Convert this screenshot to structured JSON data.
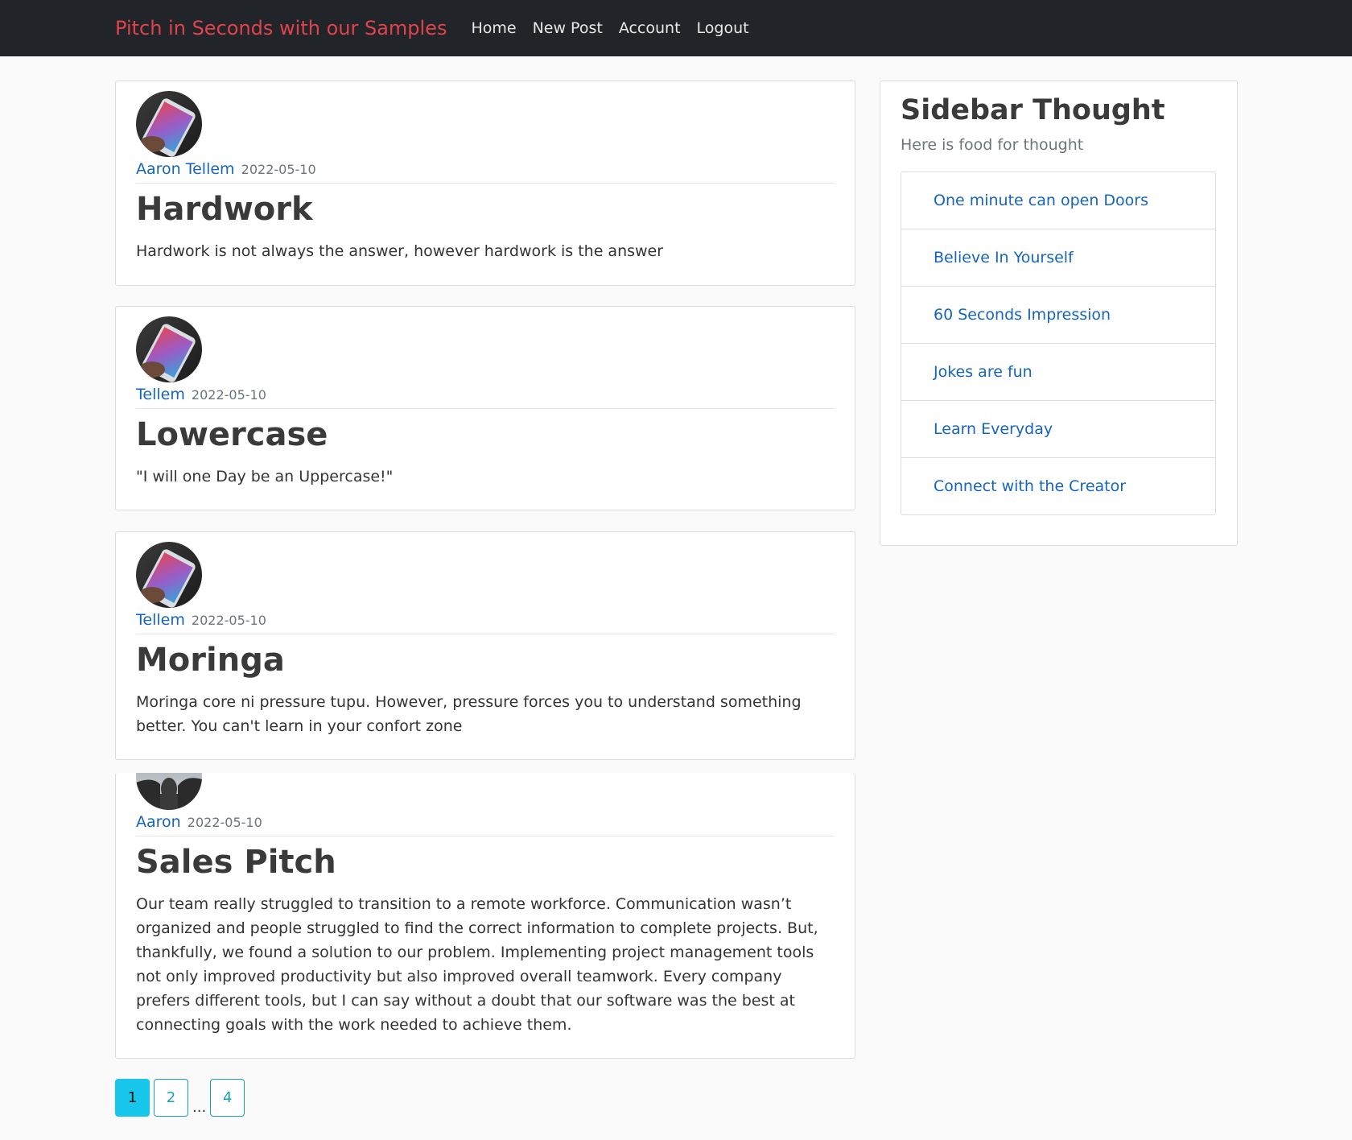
{
  "nav": {
    "brand": "Pitch in Seconds with our Samples",
    "links": [
      "Home",
      "New Post",
      "Account",
      "Logout"
    ]
  },
  "posts": [
    {
      "author": "Aaron Tellem",
      "date": "2022-05-10",
      "title": "Hardwork",
      "body": "Hardwork is not always the answer, however hardwork is the answer"
    },
    {
      "author": "Tellem",
      "date": "2022-05-10",
      "title": "Lowercase",
      "body": "\"I will one Day be an Uppercase!\""
    },
    {
      "author": "Tellem",
      "date": "2022-05-10",
      "title": "Moringa",
      "body": "Moringa core ni pressure tupu. However, pressure forces you to understand something better. You can't learn in your confort zone"
    },
    {
      "author": "Aaron",
      "date": "2022-05-10",
      "title": "Sales Pitch",
      "body": "Our team really struggled to transition to a remote workforce. Communication wasn’t organized and people struggled to find the correct information to complete projects. But, thankfully, we found a solution to our problem. Implementing project management tools not only improved productivity but also improved overall teamwork. Every company prefers different tools, but I can say without a doubt that our software was the best at connecting goals with the work needed to achieve them."
    }
  ],
  "sidebar": {
    "title": "Sidebar Thought",
    "subtitle": "Here is food for thought",
    "items": [
      "One minute can open Doors",
      "Believe In Yourself",
      "60 Seconds Impression",
      "Jokes are fun",
      "Learn Everyday",
      "Connect with the Creator"
    ]
  },
  "pagination": {
    "pages": [
      "1",
      "2",
      "4"
    ],
    "gap": "...",
    "active": "1"
  },
  "colors": {
    "navbar_bg": "#212529",
    "brand": "#e0434b",
    "link": "#1565c0",
    "page_accent": "#17a2b8",
    "page_active_bg": "#17c6ea"
  }
}
